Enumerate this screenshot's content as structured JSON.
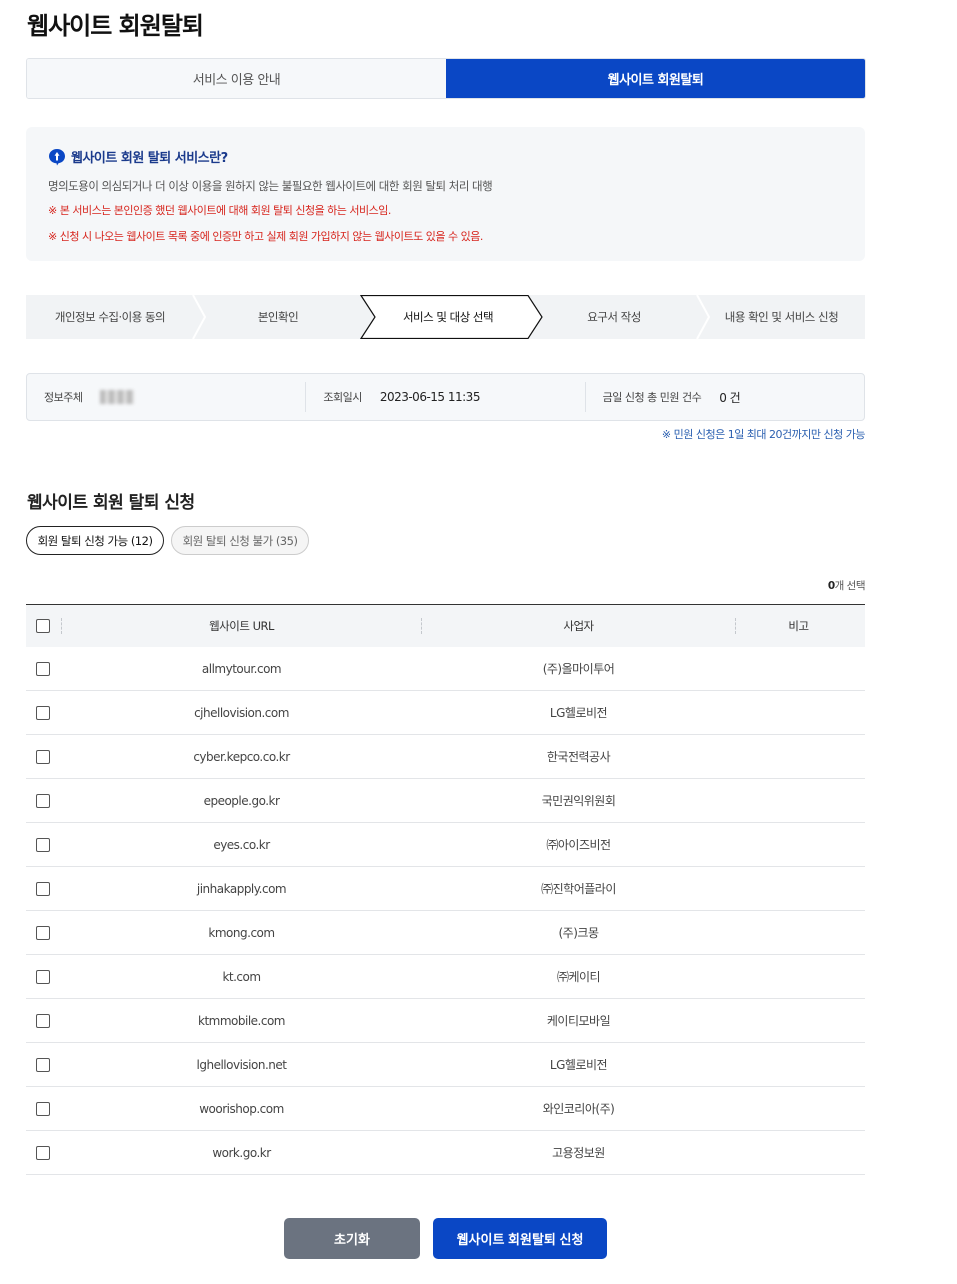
{
  "page": {
    "title": "웹사이트 회원탈퇴"
  },
  "top_tabs": [
    {
      "label": "서비스 이용 안내",
      "active": false
    },
    {
      "label": "웹사이트 회원탈퇴",
      "active": true
    }
  ],
  "info": {
    "title": "웹사이트 회원 탈퇴 서비스란?",
    "description": "명의도용이 의심되거나 더 이상 이용을 원하지 않는 불필요한 웹사이트에 대한 회원 탈퇴 처리 대행",
    "notes": [
      "※ 본 서비스는 본인인증 했던 웹사이트에 대해 회원 탈퇴 신청을 하는 서비스임.",
      "※ 신청 시 나오는 웹사이트 목록 중에 인증만 하고 실제 회원 가입하지 않는 웹사이트도 있을 수 있음."
    ]
  },
  "steps": [
    {
      "label": "개인정보 수집·이용 동의",
      "active": false
    },
    {
      "label": "본인확인",
      "active": false
    },
    {
      "label": "서비스 및 대상 선택",
      "active": true
    },
    {
      "label": "요구서 작성",
      "active": false
    },
    {
      "label": "내용 확인 및 서비스 신청",
      "active": false
    }
  ],
  "summary": {
    "subject_label": "정보주체",
    "query_label": "조회일시",
    "query_value": "2023-06-15 11:35",
    "count_label": "금일 신청 총 민원 건수",
    "count_value": "0 건",
    "note": "※ 민원 신청은 1일 최대 20건까지만 신청 가능"
  },
  "section": {
    "title": "웹사이트 회원 탈퇴 신청"
  },
  "filters": [
    {
      "label": "회원 탈퇴 신청 가능 (12)",
      "active": true
    },
    {
      "label": "회원 탈퇴 신청 불가 (35)",
      "active": false
    }
  ],
  "selection": {
    "count": "0",
    "suffix": "개 선택"
  },
  "table": {
    "headers": {
      "url": "웹사이트 URL",
      "biz": "사업자",
      "note": "비고"
    },
    "rows": [
      {
        "url": "allmytour.com",
        "biz": "(주)올마이투어"
      },
      {
        "url": "cjhellovision.com",
        "biz": "LG헬로비전"
      },
      {
        "url": "cyber.kepco.co.kr",
        "biz": "한국전력공사"
      },
      {
        "url": "epeople.go.kr",
        "biz": "국민권익위원회"
      },
      {
        "url": "eyes.co.kr",
        "biz": "㈜아이즈비전"
      },
      {
        "url": "jinhakapply.com",
        "biz": "㈜진학어플라이"
      },
      {
        "url": "kmong.com",
        "biz": "(주)크몽"
      },
      {
        "url": "kt.com",
        "biz": "㈜케이티"
      },
      {
        "url": "ktmmobile.com",
        "biz": "케이티모바일"
      },
      {
        "url": "lghellovision.net",
        "biz": "LG헬로비전"
      },
      {
        "url": "woorishop.com",
        "biz": "와인코리아(주)"
      },
      {
        "url": "work.go.kr",
        "biz": "고용정보원"
      }
    ]
  },
  "buttons": {
    "reset": "초기화",
    "submit": "웹사이트 회원탈퇴 신청"
  },
  "colors": {
    "primary": "#0a47c5",
    "warning": "#d7261e",
    "link": "#2a5fb0",
    "reset": "#6b7380"
  }
}
